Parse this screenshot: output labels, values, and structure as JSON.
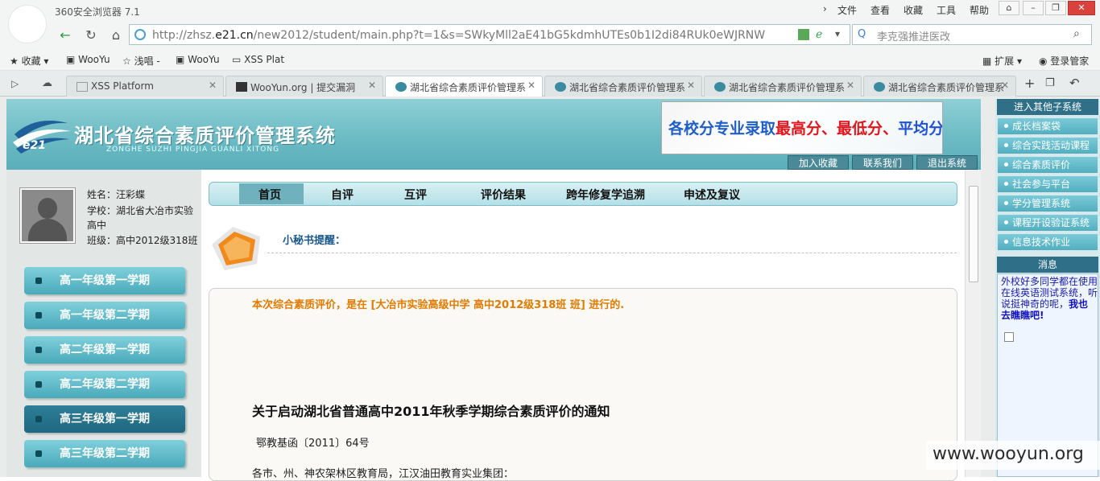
{
  "browser": {
    "title": "360安全浏览器 7.1",
    "menu": [
      "文件",
      "查看",
      "收藏",
      "工具",
      "帮助"
    ],
    "url_prefix": "http://zhsz.",
    "url_domain": "e21.cn",
    "url_rest": "/new2012/student/main.php?t=1&s=SWkyMll2aE41bG5kdmhUTEs0b1I2di84RUk0eWJRNW",
    "search_text": "李克强推进医改",
    "favorites": [
      "收藏",
      "WooYu",
      "浅唱 -",
      "WooYu",
      "XSS Plat"
    ],
    "extend_label": "扩展",
    "login_label": "登录管家",
    "tabs": [
      {
        "label": "XSS Platform",
        "active": false
      },
      {
        "label": "WooYun.org | 提交漏洞",
        "active": false
      },
      {
        "label": "湖北省综合素质评价管理系",
        "active": true
      },
      {
        "label": "湖北省综合素质评价管理系",
        "active": false
      },
      {
        "label": "湖北省综合素质评价管理系",
        "active": false
      },
      {
        "label": "湖北省综合素质评价管理系",
        "active": false
      }
    ]
  },
  "site": {
    "title": "湖北省综合素质评价管理系统",
    "subtitle": "ZONGHE SUZHI PINGJIA GUANLI XITONG",
    "logo_text": "e21",
    "banner": {
      "part1": "各校分专业录取",
      "part2": "最高分",
      "sep1": "、",
      "part3": "最低分",
      "sep2": "、",
      "part4": "平均分"
    },
    "header_buttons": [
      "加入收藏",
      "联系我们",
      "退出系统"
    ]
  },
  "student": {
    "name": "姓名：汪彩蝶",
    "school_line1": "学校：湖北省大冶市实验",
    "school_line2": "高中",
    "class": "班级：高中2012级318班"
  },
  "terms": [
    {
      "label": "高一年级第一学期",
      "selected": false
    },
    {
      "label": "高一年级第二学期",
      "selected": false
    },
    {
      "label": "高二年级第一学期",
      "selected": false
    },
    {
      "label": "高二年级第二学期",
      "selected": false
    },
    {
      "label": "高三年级第一学期",
      "selected": true
    },
    {
      "label": "高三年级第二学期",
      "selected": false
    }
  ],
  "nav": [
    "首页",
    "自评",
    "互评",
    "评价结果",
    "跨年修复学追溯",
    "申述及复议"
  ],
  "secretary_title": "小秘书提醒：",
  "notice": {
    "eval_line": "本次综合素质评价，是在 [大冶市实验高级中学 高中2012级318班 班] 进行的.",
    "title": "关于启动湖北省普通高中2011年秋季学期综合素质评价的通知",
    "doc_no": "鄂教基函〔2011〕64号",
    "addressee": "各市、州、神农架林区教育局，江汉油田教育实业集团："
  },
  "sidebar": {
    "header": "进入其他子系统",
    "items": [
      "成长档案袋",
      "综合实践活动课程",
      "综合素质评价",
      "社会参与平台",
      "学分管理系统",
      "课程开设验证系统",
      "信息技术作业"
    ],
    "msg_header": "消息",
    "msg_text": "外校好多同学都在使用在线英语测试系统，听说挺神奇的呢，",
    "msg_link": "我也去瞧瞧吧!"
  },
  "watermark": "www.wooyun.org"
}
